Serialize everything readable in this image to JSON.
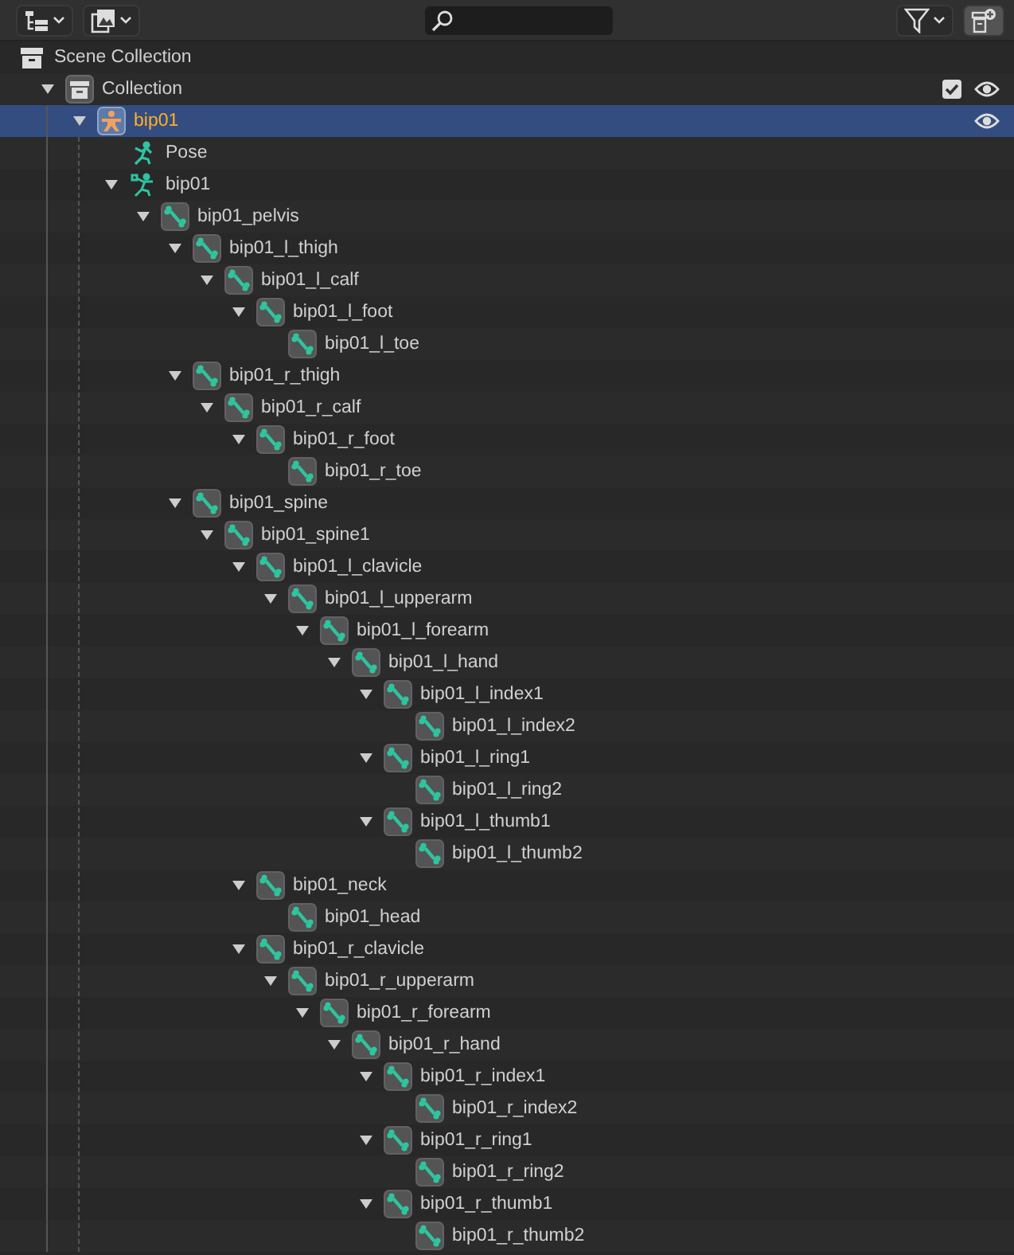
{
  "tree": [
    {
      "kind": "scene_collection",
      "name": "Scene Collection",
      "children": [
        {
          "kind": "collection",
          "name": "Collection",
          "expanded": true,
          "selected": false,
          "exclude_checked": true,
          "visible": true,
          "children": [
            {
              "kind": "object",
              "name": "bip01",
              "expanded": true,
              "selected": true,
              "visible": true,
              "children": [
                {
                  "kind": "pose",
                  "name": "Pose",
                  "selected": false
                },
                {
                  "kind": "armature",
                  "name": "bip01",
                  "expanded": true,
                  "selected": false,
                  "children": [
                    {
                      "kind": "bone",
                      "name": "bip01_pelvis",
                      "expanded": true,
                      "selected": false,
                      "children": [
                        {
                          "kind": "bone",
                          "name": "bip01_l_thigh",
                          "expanded": true,
                          "selected": false,
                          "children": [
                            {
                              "kind": "bone",
                              "name": "bip01_l_calf",
                              "expanded": true,
                              "selected": false,
                              "children": [
                                {
                                  "kind": "bone",
                                  "name": "bip01_l_foot",
                                  "expanded": true,
                                  "selected": false,
                                  "children": [
                                    {
                                      "kind": "bone",
                                      "name": "bip01_l_toe",
                                      "selected": false
                                    }
                                  ]
                                }
                              ]
                            }
                          ]
                        },
                        {
                          "kind": "bone",
                          "name": "bip01_r_thigh",
                          "expanded": true,
                          "selected": false,
                          "children": [
                            {
                              "kind": "bone",
                              "name": "bip01_r_calf",
                              "expanded": true,
                              "selected": false,
                              "children": [
                                {
                                  "kind": "bone",
                                  "name": "bip01_r_foot",
                                  "expanded": true,
                                  "selected": false,
                                  "children": [
                                    {
                                      "kind": "bone",
                                      "name": "bip01_r_toe",
                                      "selected": false
                                    }
                                  ]
                                }
                              ]
                            }
                          ]
                        },
                        {
                          "kind": "bone",
                          "name": "bip01_spine",
                          "expanded": true,
                          "selected": false,
                          "children": [
                            {
                              "kind": "bone",
                              "name": "bip01_spine1",
                              "expanded": true,
                              "selected": false,
                              "children": [
                                {
                                  "kind": "bone",
                                  "name": "bip01_l_clavicle",
                                  "expanded": true,
                                  "selected": false,
                                  "children": [
                                    {
                                      "kind": "bone",
                                      "name": "bip01_l_upperarm",
                                      "expanded": true,
                                      "selected": false,
                                      "children": [
                                        {
                                          "kind": "bone",
                                          "name": "bip01_l_forearm",
                                          "expanded": true,
                                          "selected": false,
                                          "children": [
                                            {
                                              "kind": "bone",
                                              "name": "bip01_l_hand",
                                              "expanded": true,
                                              "selected": false,
                                              "children": [
                                                {
                                                  "kind": "bone",
                                                  "name": "bip01_l_index1",
                                                  "expanded": true,
                                                  "selected": false,
                                                  "children": [
                                                    {
                                                      "kind": "bone",
                                                      "name": "bip01_l_index2",
                                                      "selected": false
                                                    }
                                                  ]
                                                },
                                                {
                                                  "kind": "bone",
                                                  "name": "bip01_l_ring1",
                                                  "expanded": true,
                                                  "selected": false,
                                                  "children": [
                                                    {
                                                      "kind": "bone",
                                                      "name": "bip01_l_ring2",
                                                      "selected": false
                                                    }
                                                  ]
                                                },
                                                {
                                                  "kind": "bone",
                                                  "name": "bip01_l_thumb1",
                                                  "expanded": true,
                                                  "selected": false,
                                                  "children": [
                                                    {
                                                      "kind": "bone",
                                                      "name": "bip01_l_thumb2",
                                                      "selected": false
                                                    }
                                                  ]
                                                }
                                              ]
                                            }
                                          ]
                                        }
                                      ]
                                    }
                                  ]
                                },
                                {
                                  "kind": "bone",
                                  "name": "bip01_neck",
                                  "expanded": true,
                                  "selected": false,
                                  "children": [
                                    {
                                      "kind": "bone",
                                      "name": "bip01_head",
                                      "selected": false
                                    }
                                  ]
                                },
                                {
                                  "kind": "bone",
                                  "name": "bip01_r_clavicle",
                                  "expanded": true,
                                  "selected": false,
                                  "children": [
                                    {
                                      "kind": "bone",
                                      "name": "bip01_r_upperarm",
                                      "expanded": true,
                                      "selected": false,
                                      "children": [
                                        {
                                          "kind": "bone",
                                          "name": "bip01_r_forearm",
                                          "expanded": true,
                                          "selected": false,
                                          "children": [
                                            {
                                              "kind": "bone",
                                              "name": "bip01_r_hand",
                                              "expanded": true,
                                              "selected": false,
                                              "children": [
                                                {
                                                  "kind": "bone",
                                                  "name": "bip01_r_index1",
                                                  "expanded": true,
                                                  "selected": false,
                                                  "children": [
                                                    {
                                                      "kind": "bone",
                                                      "name": "bip01_r_index2",
                                                      "selected": false
                                                    }
                                                  ]
                                                },
                                                {
                                                  "kind": "bone",
                                                  "name": "bip01_r_ring1",
                                                  "expanded": true,
                                                  "selected": false,
                                                  "children": [
                                                    {
                                                      "kind": "bone",
                                                      "name": "bip01_r_ring2",
                                                      "selected": false
                                                    }
                                                  ]
                                                },
                                                {
                                                  "kind": "bone",
                                                  "name": "bip01_r_thumb1",
                                                  "expanded": true,
                                                  "selected": false,
                                                  "children": [
                                                    {
                                                      "kind": "bone",
                                                      "name": "bip01_r_thumb2",
                                                      "selected": false
                                                    }
                                                  ]
                                                }
                                              ]
                                            }
                                          ]
                                        }
                                      ]
                                    }
                                  ]
                                }
                              ]
                            }
                          ]
                        }
                      ]
                    }
                  ]
                }
              ]
            }
          ]
        }
      ]
    }
  ]
}
